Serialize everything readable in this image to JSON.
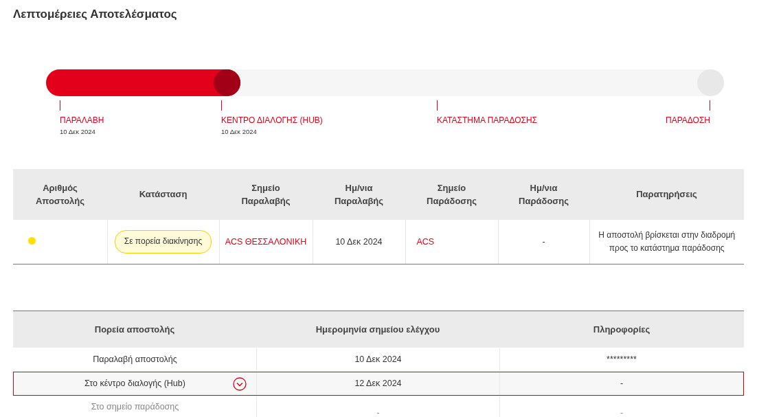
{
  "title": "Λεπτομέρειες Αποτελέσματος",
  "progress": {
    "level": 0.287,
    "stages": [
      {
        "label": "ΠΑΡΑΛΑΒΗ",
        "date": "10 Δεκ 2024"
      },
      {
        "label": "ΚΕΝΤΡΟ ΔΙΑΛΟΓΗΣ (HUB)",
        "date": "10 Δεκ 2024"
      },
      {
        "label": "ΚΑΤΑΣΤΗΜΑ ΠΑΡΑΔΟΣΗΣ"
      },
      {
        "label": "ΠΑΡΑΔΟΣΗ"
      }
    ]
  },
  "shipment_table": {
    "columns": [
      "Αριθμός Αποστολής",
      "Κατάσταση",
      "Σημείο Παραλαβής",
      "Ημ/νια Παραλαβής",
      "Σημείο Παράδοσης",
      "Ημ/νια Παράδοσης",
      "Παρατηρήσεις"
    ],
    "rows": [
      {
        "color": "#ffe000",
        "status": "Σε πορεία διακίνησης",
        "pickup_point": "ACS ΘΕΣΣΑΛΟΝΙΚΗ",
        "pickup_date": "10 Δεκ 2024",
        "delivery_point": "ACS",
        "delivery_date": "-",
        "notes": "Η αποστολή βρίσκεται στην διαδρομή προς το κατάστημα παράδοσης"
      }
    ]
  },
  "history_table": {
    "columns": [
      "Πορεία αποστολής",
      "Ημερομηνία σημείου ελέγχου",
      "Πληροφορίες"
    ],
    "rows": [
      {
        "step": "Παραλαβή αποστολής",
        "date": "10 Δεκ 2024",
        "info": "*********",
        "selected": false,
        "disabled": false
      },
      {
        "step": "Στο κέντρο διαλογής (Hub)",
        "date": "12 Δεκ 2024",
        "info": "-",
        "selected": true,
        "disabled": false
      },
      {
        "step": "Στο σημείο παράδοσης",
        "date": "-",
        "info": "-",
        "selected": false,
        "disabled": true
      }
    ]
  }
}
